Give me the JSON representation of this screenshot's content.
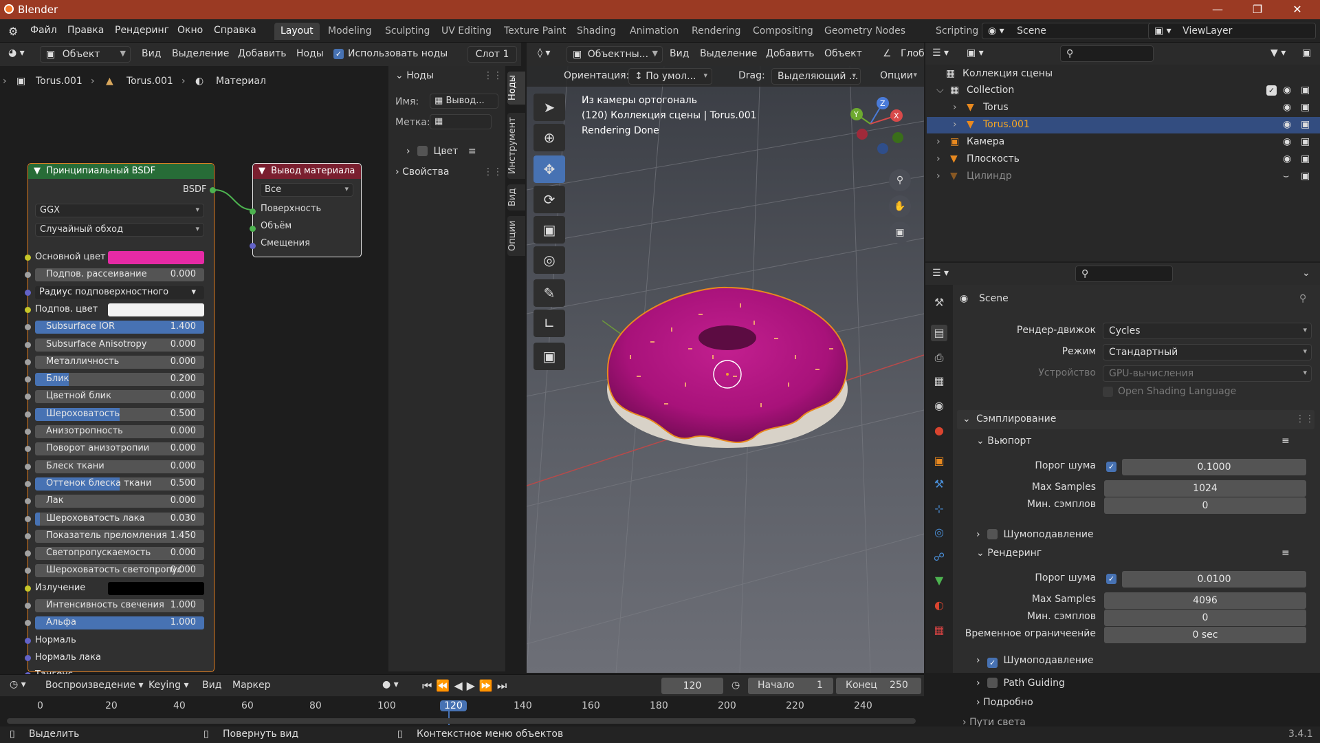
{
  "title": "Blender",
  "menu": [
    "Файл",
    "Правка",
    "Рендеринг",
    "Окно",
    "Справка"
  ],
  "workspaces": [
    "Layout",
    "Modeling",
    "Sculpting",
    "UV Editing",
    "Texture Paint",
    "Shading",
    "Animation",
    "Rendering",
    "Compositing",
    "Geometry Nodes",
    "Scripting"
  ],
  "active_workspace": "Layout",
  "scene": "Scene",
  "view_layer": "ViewLayer",
  "node_editor": {
    "mode": "Объект",
    "menus": [
      "Вид",
      "Выделение",
      "Добавить",
      "Ноды"
    ],
    "use_nodes_label": "Использовать ноды",
    "slot": "Слот 1",
    "breadcrumb": [
      "Torus.001",
      "Torus.001",
      "Материал"
    ],
    "bsdf_node": {
      "title": "Принципиальный BSDF",
      "output": "BSDF",
      "distribution": "GGX",
      "subsurface_method": "Случайный обход",
      "rows": [
        {
          "label": "Основной цвет",
          "type": "color",
          "color": "#e62aa5",
          "sock": "#c7c729"
        },
        {
          "label": "Подпов. рассеивание",
          "value": "0.000",
          "fill": 0,
          "sock": "#a1a1a1"
        },
        {
          "label": "Радиус подповерхностного рассе...",
          "type": "dropdown",
          "sock": "#6363c7"
        },
        {
          "label": "Подпов. цвет",
          "type": "color",
          "color": "#f2f2f2",
          "sock": "#c7c729"
        },
        {
          "label": "Subsurface IOR",
          "value": "1.400",
          "fill": 1,
          "sock": "#a1a1a1"
        },
        {
          "label": "Subsurface Anisotropy",
          "value": "0.000",
          "fill": 0,
          "sock": "#a1a1a1"
        },
        {
          "label": "Металличность",
          "value": "0.000",
          "fill": 0,
          "sock": "#a1a1a1"
        },
        {
          "label": "Блик",
          "value": "0.200",
          "fill": 0.2,
          "sock": "#a1a1a1"
        },
        {
          "label": "Цветной блик",
          "value": "0.000",
          "fill": 0,
          "sock": "#a1a1a1"
        },
        {
          "label": "Шероховатость",
          "value": "0.500",
          "fill": 0.5,
          "sock": "#a1a1a1"
        },
        {
          "label": "Анизотропность",
          "value": "0.000",
          "fill": 0,
          "sock": "#a1a1a1"
        },
        {
          "label": "Поворот анизотропии",
          "value": "0.000",
          "fill": 0,
          "sock": "#a1a1a1"
        },
        {
          "label": "Блеск ткани",
          "value": "0.000",
          "fill": 0,
          "sock": "#a1a1a1"
        },
        {
          "label": "Оттенок блеска ткани",
          "value": "0.500",
          "fill": 0.5,
          "sock": "#a1a1a1"
        },
        {
          "label": "Лак",
          "value": "0.000",
          "fill": 0,
          "sock": "#a1a1a1"
        },
        {
          "label": "Шероховатость лака",
          "value": "0.030",
          "fill": 0.03,
          "sock": "#a1a1a1"
        },
        {
          "label": "Показатель преломления",
          "value": "1.450",
          "fill": 0,
          "sock": "#a1a1a1"
        },
        {
          "label": "Светопропускаемость",
          "value": "0.000",
          "fill": 0,
          "sock": "#a1a1a1"
        },
        {
          "label": "Шероховатость светопропус",
          "value": "0.000",
          "fill": 0,
          "sock": "#a1a1a1"
        },
        {
          "label": "Излучение",
          "type": "color",
          "color": "#000000",
          "sock": "#c7c729"
        },
        {
          "label": "Интенсивность свечения",
          "value": "1.000",
          "fill": 0,
          "sock": "#a1a1a1"
        },
        {
          "label": "Альфа",
          "value": "1.000",
          "fill": 1,
          "sock": "#a1a1a1"
        },
        {
          "label": "Нормаль",
          "type": "plain",
          "sock": "#6363c7"
        },
        {
          "label": "Нормаль лака",
          "type": "plain",
          "sock": "#6363c7"
        },
        {
          "label": "Тангенс",
          "type": "plain",
          "sock": "#6363c7"
        }
      ]
    },
    "output_node": {
      "title": "Вывод материала",
      "target": "Все",
      "inputs": [
        "Поверхность",
        "Объём",
        "Смещения"
      ]
    },
    "sidebar": {
      "panel_nodes": "Ноды",
      "name_label": "Имя:",
      "name_value": "Вывод...",
      "label_label": "Метка:",
      "color_label": "Цвет",
      "properties_label": "Свойства",
      "tabs": [
        "Ноды",
        "Инструмент",
        "Вид",
        "Опции"
      ]
    }
  },
  "viewport": {
    "mode": "Объектны...",
    "menus": [
      "Вид",
      "Выделение",
      "Добавить",
      "Объект"
    ],
    "global": "Глоб",
    "orientation_label": "Ориентация:",
    "orientation_value": "По умол...",
    "drag_label": "Drag:",
    "drag_value": "Выделяющий ...",
    "options": "Опции",
    "overlay_text": [
      "Из камеры ортогональ",
      "(120) Коллекция сцены | Torus.001",
      "Rendering Done"
    ]
  },
  "outliner": {
    "root": "Коллекция сцены",
    "items": [
      {
        "name": "Collection",
        "level": 1,
        "type": "collection"
      },
      {
        "name": "Torus",
        "level": 2,
        "type": "mesh"
      },
      {
        "name": "Torus.001",
        "level": 2,
        "type": "mesh",
        "selected": true
      },
      {
        "name": "Камера",
        "level": 1,
        "type": "camera"
      },
      {
        "name": "Плоскость",
        "level": 1,
        "type": "mesh"
      },
      {
        "name": "Цилиндр",
        "level": 1,
        "type": "mesh",
        "dimmed": true
      }
    ]
  },
  "properties": {
    "context": "Scene",
    "render_engine_label": "Рендер-движок",
    "render_engine": "Cycles",
    "mode_label": "Режим",
    "mode": "Стандартный",
    "device_label": "Устройство",
    "device": "GPU-вычисления",
    "osl_label": "Open Shading Language",
    "sampling_label": "Сэмплирование",
    "viewport_label": "Вьюпорт",
    "noise_threshold_label": "Порог шума",
    "viewport_noise": "0.1000",
    "max_samples_label": "Max Samples",
    "viewport_max": "1024",
    "min_samples_label": "Мин. сэмплов",
    "viewport_min": "0",
    "denoise_label": "Шумоподавление",
    "render_label": "Рендеринг",
    "render_noise": "0.0100",
    "render_max": "4096",
    "render_min": "0",
    "time_limit_label": "Временное ограничеенйе",
    "time_limit": "0 sec",
    "path_guiding_label": "Path Guiding",
    "advanced_label": "Подробно",
    "light_paths_label": "Пути света"
  },
  "timeline": {
    "playback": "Воспроизведение",
    "keying": "Keying",
    "view": "Вид",
    "marker": "Маркер",
    "current_frame": "120",
    "start_label": "Начало",
    "start": "1",
    "end_label": "Конец",
    "end": "250",
    "ticks": [
      "0",
      "20",
      "40",
      "60",
      "80",
      "100",
      "120",
      "140",
      "160",
      "180",
      "200",
      "220",
      "240"
    ]
  },
  "statusbar": {
    "select": "Выделить",
    "rotate": "Повернуть вид",
    "context_menu": "Контекстное меню объектов",
    "version": "3.4.1"
  }
}
